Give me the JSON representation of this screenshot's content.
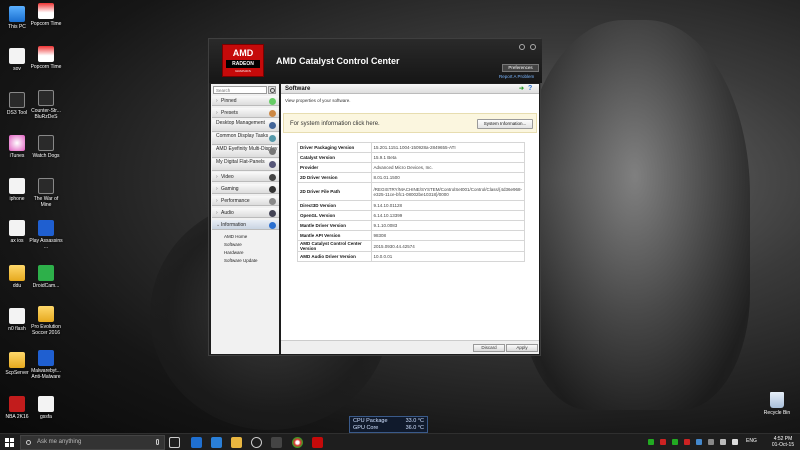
{
  "desktop": {
    "icons": [
      {
        "label": "This PC"
      },
      {
        "label": "Popcorn Time"
      },
      {
        "label": "sov"
      },
      {
        "label": "Popcorn Time"
      },
      {
        "label": "DS3 Tool"
      },
      {
        "label": "Counter-Str... BluRzDeS"
      },
      {
        "label": "iTunes"
      },
      {
        "label": "Watch Dogs"
      },
      {
        "label": "iphone"
      },
      {
        "label": "The War of Mine"
      },
      {
        "label": "ax ios"
      },
      {
        "label": "Play Assassins ..."
      },
      {
        "label": "ddu"
      },
      {
        "label": "DroidCam..."
      },
      {
        "label": "n0 flash"
      },
      {
        "label": "Pro Evolution Soccer 2016"
      },
      {
        "label": "ScpServer"
      },
      {
        "label": "Malwarebyt... Anti-Malware"
      },
      {
        "label": "NBA 2K16"
      },
      {
        "label": "gssfa"
      }
    ],
    "recycle_bin": "Recycle Bin"
  },
  "window": {
    "logo": {
      "brand": "AMD",
      "line": "RADEON",
      "sub": "GRAPHICS"
    },
    "title": "AMD Catalyst Control Center",
    "preferences": "Preferences",
    "report": "Report A Problem"
  },
  "sidebar": {
    "search_placeholder": "Search",
    "items": [
      {
        "label": "Pinned"
      },
      {
        "label": "Presets"
      },
      {
        "label": "Desktop Management"
      },
      {
        "label": "Common Display Tasks"
      },
      {
        "label": "AMD Eyefinity Multi-Display"
      },
      {
        "label": "My Digital Flat-Panels"
      },
      {
        "label": "Video"
      },
      {
        "label": "Gaming"
      },
      {
        "label": "Performance"
      },
      {
        "label": "Audio"
      },
      {
        "label": "Information"
      }
    ],
    "sub_items": [
      "AMD Home",
      "Software",
      "Hardware",
      "Software Update"
    ]
  },
  "main": {
    "header": "Software",
    "subtitle": "View properties of your software.",
    "info_text": "For system information click here.",
    "info_button": "System Information...",
    "rows": [
      {
        "key": "Driver Packaging Version",
        "value": "15.201.1151.1004-150928a-2849655-ATI"
      },
      {
        "key": "Catalyst Version",
        "value": "15.9.1 Beta"
      },
      {
        "key": "Provider",
        "value": "Advanced Micro Devices, Inc."
      },
      {
        "key": "2D Driver Version",
        "value": "8.01.01.1500"
      },
      {
        "key": "2D Driver File Path",
        "value": "/REGISTRY/MACHINE/SYSTEM/ControlSet001/Control/Class/{4d36e968-e325-11ce-bfc1-08002be10318}/0000"
      },
      {
        "key": "Direct3D Version",
        "value": "9.14.10.01128"
      },
      {
        "key": "OpenGL Version",
        "value": "6.14.10.13399"
      },
      {
        "key": "Mantle Driver Version",
        "value": "9.1.10.0083"
      },
      {
        "key": "Mantle API Version",
        "value": "98308"
      },
      {
        "key": "AMD Catalyst Control Center Version",
        "value": "2015.0930.44.42574"
      },
      {
        "key": "AMD Audio Driver Version",
        "value": "10.0.0.01"
      }
    ],
    "discard": "Discard",
    "apply": "Apply"
  },
  "gpu_overlay": {
    "cpu_label": "CPU Package",
    "cpu_temp": "33.0 °C",
    "gpu_label": "GPU Core",
    "gpu_temp": "36.0 °C"
  },
  "taskbar": {
    "search_placeholder": "Ask me anything",
    "language": "ENG",
    "time": "4:52 PM",
    "date": "01-Oct-15"
  }
}
